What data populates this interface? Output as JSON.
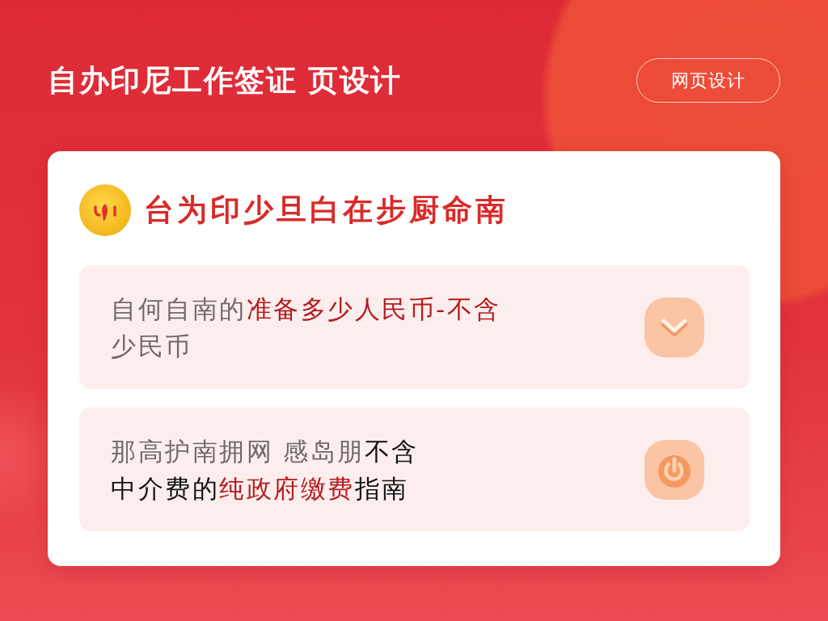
{
  "header": {
    "title": "自办印尼工作签证 页设计",
    "button": "网页设计"
  },
  "card": {
    "heading": "台为印少旦白在步厨命南",
    "items": [
      {
        "lines": [
          [
            {
              "text": "自何自南的",
              "faded": true,
              "highlighted": false
            },
            {
              "text": "准备多少人民币-不含",
              "faded": false,
              "highlighted": true
            }
          ],
          [
            {
              "text": "少民币",
              "faded": true,
              "highlighted": false
            }
          ]
        ]
      },
      {
        "lines": [
          [
            {
              "text": "那高护南拥网 感岛朋",
              "faded": true,
              "highlighted": false
            },
            {
              "text": "不含",
              "faded": false,
              "highlighted": false
            }
          ],
          [
            {
              "text": "中介费的",
              "faded": false,
              "highlighted": false
            },
            {
              "text": "纯政府缴费",
              "faded": false,
              "highlighted": true
            },
            {
              "text": "指南",
              "faded": false,
              "highlighted": false
            }
          ]
        ]
      }
    ]
  }
}
